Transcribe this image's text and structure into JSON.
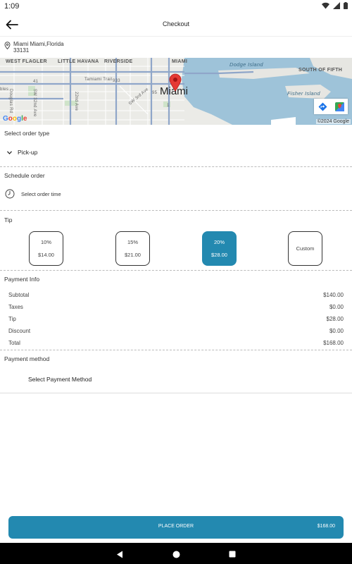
{
  "status_bar": {
    "time": "1:09"
  },
  "app_bar": {
    "title": "Checkout",
    "back_icon": "arrow-left-icon"
  },
  "address": {
    "line1": "Miami  Miami,Florida",
    "line2": "33131"
  },
  "map": {
    "labels": {
      "west_flagler": "WEST FLAGLER",
      "little_havana": "LITTLE HAVANA",
      "riverside": "RIVERSIDE",
      "miami_small": "MIAMI",
      "dodge_island": "Dodge Island",
      "south_of_fifth": "SOUTH OF FIFTH",
      "miami_city": "Miami",
      "tamiami": "Tamiami Trail",
      "fisher_island": "Fisher Island",
      "sw_3rd": "SW 3rd Ave",
      "douglas": "Douglas Rd",
      "sw32": "SW 32nd Ave",
      "sw22": "22nd Ave",
      "ples": "bles",
      "r41": "41",
      "r933": "933",
      "r95": "95",
      "r1": "1"
    },
    "google": [
      "G",
      "o",
      "o",
      "g",
      "l",
      "e"
    ],
    "copyright": "©2024 Google",
    "water_color": "#9ec3d9"
  },
  "order_type": {
    "section_title": "Select order type",
    "value": "Pick-up"
  },
  "schedule": {
    "section_title": "Schedule order",
    "label": "Select order time"
  },
  "tip": {
    "section_title": "Tip",
    "options": [
      {
        "percent": "10%",
        "amount": "$14.00",
        "selected": false
      },
      {
        "percent": "15%",
        "amount": "$21.00",
        "selected": false
      },
      {
        "percent": "20%",
        "amount": "$28.00",
        "selected": true
      },
      {
        "label": "Custom",
        "selected": false
      }
    ]
  },
  "payment_info": {
    "section_title": "Payment Info",
    "rows": [
      {
        "label": "Subtotal",
        "value": "$140.00"
      },
      {
        "label": "Taxes",
        "value": "$0.00"
      },
      {
        "label": "Tip",
        "value": "$28.00"
      },
      {
        "label": "Discount",
        "value": "$0.00"
      },
      {
        "label": "Total",
        "value": "$168.00"
      }
    ]
  },
  "payment_method": {
    "section_title": "Payment method",
    "button_label": "Select Payment Method"
  },
  "place_order": {
    "label": "PLACE ORDER",
    "price": "$168.00"
  },
  "colors": {
    "accent": "#2389b0",
    "pin": "#e53935"
  }
}
